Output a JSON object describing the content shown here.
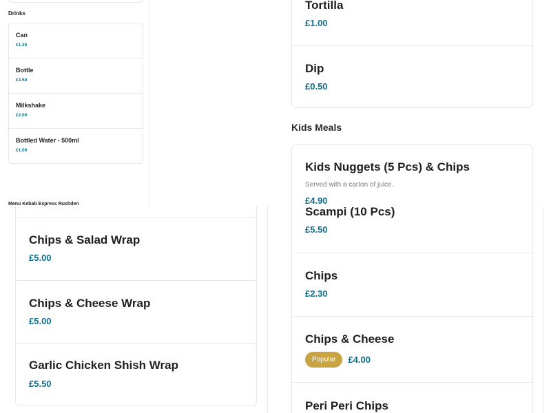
{
  "drinks": {
    "heading": "Drinks",
    "items": [
      {
        "name": "Can",
        "price": "£1.20"
      },
      {
        "name": "Bottle",
        "price": "£3.50"
      },
      {
        "name": "Milkshake",
        "price": "£2.00"
      },
      {
        "name": "Bottled Water - 500ml",
        "price": "£1.00"
      }
    ]
  },
  "footer": {
    "text": "Menu Kebab Express Rushden"
  },
  "sides_top": {
    "items": [
      {
        "name": "Tortilla",
        "price": "£1.00"
      },
      {
        "name": "Dip",
        "price": "£0.50"
      }
    ]
  },
  "kids_meals": {
    "heading": "Kids Meals",
    "items": [
      {
        "name": "Kids Nuggets (5 Pcs) & Chips",
        "description": "Served with a carton of juice.",
        "price": "£4.90"
      }
    ]
  },
  "wraps": {
    "items": [
      {
        "name": "Chips & Salad Wrap",
        "price": "£5.00"
      },
      {
        "name": "Chips & Cheese Wrap",
        "price": "£5.00"
      },
      {
        "name": "Garlic Chicken Shish Wrap",
        "price": "£5.50"
      }
    ]
  },
  "sides_bottom": {
    "items": [
      {
        "name": "Scampi (10 Pcs)",
        "price": "£5.50"
      },
      {
        "name": "Chips",
        "price": "£2.30"
      },
      {
        "name": "Chips & Cheese",
        "badge": "Popular",
        "price": "£4.00"
      },
      {
        "name": "Peri Peri Chips"
      }
    ]
  }
}
